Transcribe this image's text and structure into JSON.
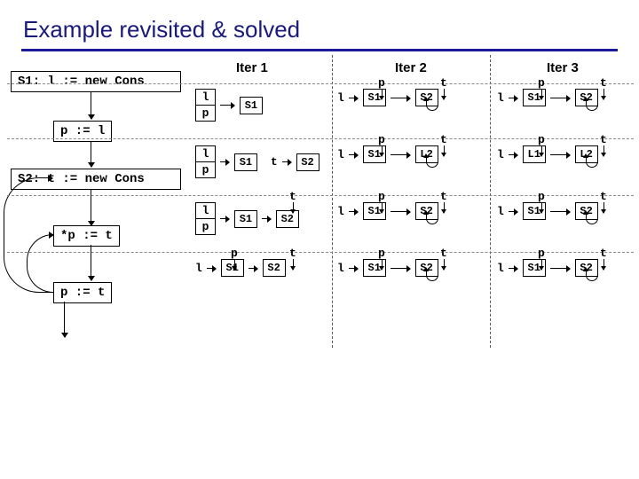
{
  "title": "Example revisited & solved",
  "flow": {
    "s1": "S1: l := new Cons",
    "s2": "p := l",
    "s3": "S2: t := new Cons",
    "s4": "*p := t",
    "s5": "p := t"
  },
  "iters": {
    "i1": "Iter 1",
    "i2": "Iter 2",
    "i3": "Iter 3"
  },
  "vars": {
    "l": "l",
    "p": "p",
    "t": "t"
  },
  "nodes": {
    "S1": "S1",
    "S2": "S2",
    "L1": "L1",
    "L2": "L2"
  }
}
